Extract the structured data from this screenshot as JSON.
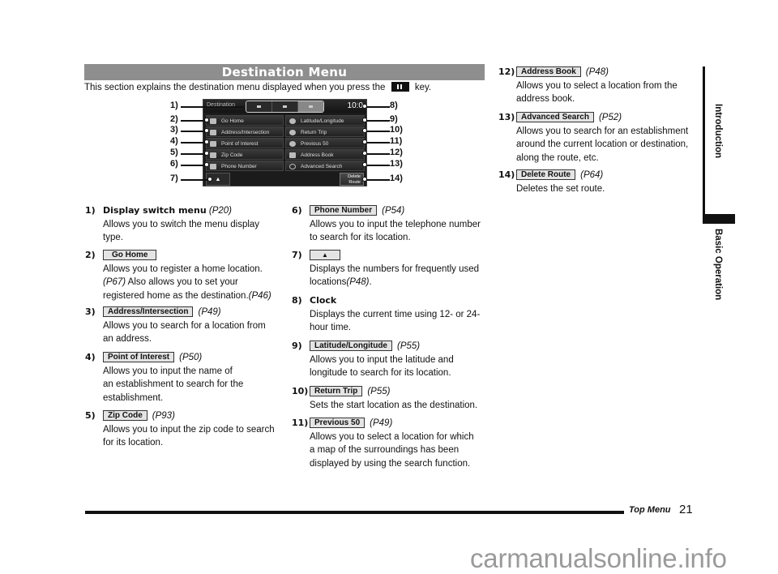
{
  "section": {
    "title": "Destination Menu",
    "intro_before": "This section explains the destination menu displayed when you press the",
    "intro_key_icon": "destination-flag-key-icon",
    "intro_after": "key."
  },
  "screen": {
    "title": "Destination",
    "clock": "10:0",
    "left_buttons": [
      {
        "label": "Go Home",
        "icon": "home-icon"
      },
      {
        "label": "Address/Intersection",
        "icon": "intersection-icon"
      },
      {
        "label": "Point of Interest",
        "icon": "poi-icon"
      },
      {
        "label": "Zip Code",
        "icon": "zip-icon"
      },
      {
        "label": "Phone Number",
        "icon": "phone-icon"
      }
    ],
    "right_buttons": [
      {
        "label": "Latitude/Longitude",
        "icon": "globe-icon"
      },
      {
        "label": "Return Trip",
        "icon": "return-icon"
      },
      {
        "label": "Previous 50",
        "icon": "history-icon"
      },
      {
        "label": "Address Book",
        "icon": "book-icon"
      },
      {
        "label": "Advanced Search",
        "icon": "search-icon"
      }
    ],
    "up_button": "▲",
    "delete_route_line1": "Delete",
    "delete_route_line2": "Route"
  },
  "callouts": {
    "left": [
      "1)",
      "2)",
      "3)",
      "4)",
      "5)",
      "6)",
      "7)"
    ],
    "right": [
      "8)",
      "9)",
      "10)",
      "11)",
      "12)",
      "13)",
      "14)"
    ]
  },
  "items": [
    {
      "num": "1)",
      "title": "Display switch menu",
      "ref": "(P20)",
      "lines": [
        "Allows you to switch the menu display",
        "type."
      ]
    },
    {
      "num": "2)",
      "button": "Go Home",
      "ref": "",
      "lines": [
        "Allows you to register a home location."
      ],
      "line2_ref": "(P67)",
      "line2_text": " Also allows you to set your",
      "line3_text": "registered home as the destination.",
      "line3_ref": "(P46)"
    },
    {
      "num": "3)",
      "button": "Address/Intersection",
      "ref": "(P49)",
      "lines": [
        "Allows you to search for a location from",
        "an address."
      ]
    },
    {
      "num": "4)",
      "button": "Point of Interest",
      "ref": "(P50)",
      "lines": [
        "Allows you to input the name of",
        "an establishment to search for the",
        "establishment."
      ]
    },
    {
      "num": "5)",
      "button": "Zip Code",
      "ref": "(P93)",
      "lines": [
        "Allows you to input the zip code to search",
        "for its location."
      ]
    },
    {
      "num": "6)",
      "button": "Phone Number",
      "ref": "(P54)",
      "lines": [
        "Allows you to input the telephone number",
        "to search for its location."
      ]
    },
    {
      "num": "7)",
      "button": "▲",
      "ref": "",
      "lines": [
        "Displays the numbers for frequently used"
      ],
      "last_text": "locations",
      "last_ref": "(P48)",
      "last_end": "."
    },
    {
      "num": "8)",
      "title": "Clock",
      "ref": "",
      "lines": [
        "Displays the current time using 12- or 24-",
        "hour time."
      ]
    },
    {
      "num": "9)",
      "button": "Latitude/Longitude",
      "ref": "(P55)",
      "lines": [
        "Allows you to input the latitude and",
        "longitude to search for its location."
      ]
    },
    {
      "num": "10)",
      "button": "Return Trip",
      "ref": "(P55)",
      "lines": [
        "Sets the start location as the destination."
      ]
    },
    {
      "num": "11)",
      "button": "Previous 50",
      "ref": "(P49)",
      "lines": [
        "Allows you to select a location for which",
        "a map of the surroundings has been",
        "displayed by using the search function."
      ]
    },
    {
      "num": "12)",
      "button": "Address Book",
      "ref": "(P48)",
      "lines": [
        "Allows you to select a location from the",
        "address book."
      ]
    },
    {
      "num": "13)",
      "button": "Advanced Search",
      "ref": "(P52)",
      "lines": [
        "Allows you to search for an establishment",
        "around the current location or destination,",
        "along the route, etc."
      ]
    },
    {
      "num": "14)",
      "button": "Delete Route",
      "ref": "(P64)",
      "lines": [
        "Deletes the set route."
      ]
    }
  ],
  "side_tabs": {
    "tab1": "Introduction",
    "tab2": "Basic Operation"
  },
  "footer": {
    "section": "Top Menu",
    "page": "21"
  },
  "watermark": "carmanualsonline.info"
}
